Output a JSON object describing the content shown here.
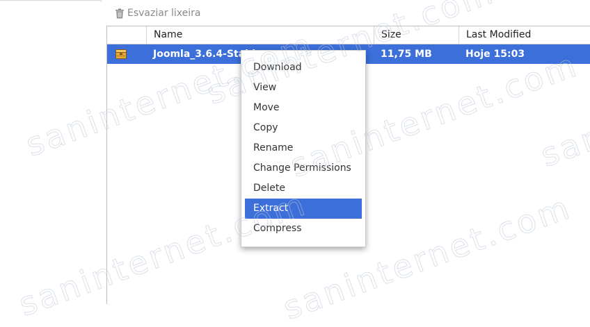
{
  "toolbar": {
    "empty_trash_label": "Esvaziar lixeira",
    "empty_trash_icon": "trash-icon"
  },
  "table": {
    "columns": [
      "",
      "Name",
      "Size",
      "Last Modified"
    ],
    "rows": [
      {
        "icon": "archive-icon",
        "name": "Joomla_3.6.4-Stable",
        "size": "11,75 MB",
        "modified": "Hoje 15:03",
        "selected": true
      }
    ]
  },
  "context_menu": {
    "items": [
      {
        "label": "Download"
      },
      {
        "label": "View"
      },
      {
        "label": "Move"
      },
      {
        "label": "Copy"
      },
      {
        "label": "Rename"
      },
      {
        "label": "Change Permissions"
      },
      {
        "label": "Delete"
      },
      {
        "label": "Extract",
        "active": true
      },
      {
        "label": "Compress"
      }
    ]
  },
  "watermark": {
    "text": "saninternet.com"
  },
  "colors": {
    "selection": "#3c6fd9",
    "header_text": "#222222",
    "toolbar_text": "#8a8a8a"
  }
}
